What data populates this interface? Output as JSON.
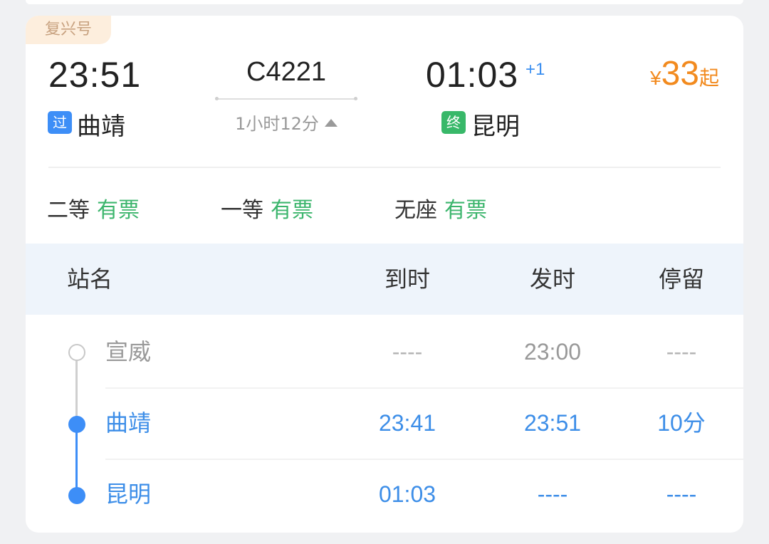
{
  "train": {
    "type_tag": "复兴号",
    "dep_time": "23:51",
    "number": "C4221",
    "duration": "1小时12分",
    "arr_time": "01:03",
    "arr_day_offset": "+1",
    "dep_badge": "过",
    "dep_station": "曲靖",
    "arr_badge": "终",
    "arr_station": "昆明",
    "price_symbol": "¥",
    "price": "33",
    "price_suffix": "起"
  },
  "seats": [
    {
      "class": "二等",
      "status": "有票"
    },
    {
      "class": "一等",
      "status": "有票"
    },
    {
      "class": "无座",
      "status": "有票"
    }
  ],
  "table": {
    "headers": {
      "name": "站名",
      "arrive": "到时",
      "depart": "发时",
      "stop": "停留"
    },
    "rows": [
      {
        "name": "宣威",
        "arrive": "----",
        "depart": "23:00",
        "stop": "----"
      },
      {
        "name": "曲靖",
        "arrive": "23:41",
        "depart": "23:51",
        "stop": "10分"
      },
      {
        "name": "昆明",
        "arrive": "01:03",
        "depart": "----",
        "stop": "----"
      }
    ]
  },
  "colors": {
    "accent_blue": "#3d8ef7",
    "available_green": "#3bb56c",
    "price_orange": "#f28a1e",
    "tag_bg": "#fdeedd"
  },
  "icons": {
    "duration_toggle": "triangle-up-icon",
    "origin_marker": "hollow-circle-icon",
    "current_marker": "filled-circle-icon"
  }
}
